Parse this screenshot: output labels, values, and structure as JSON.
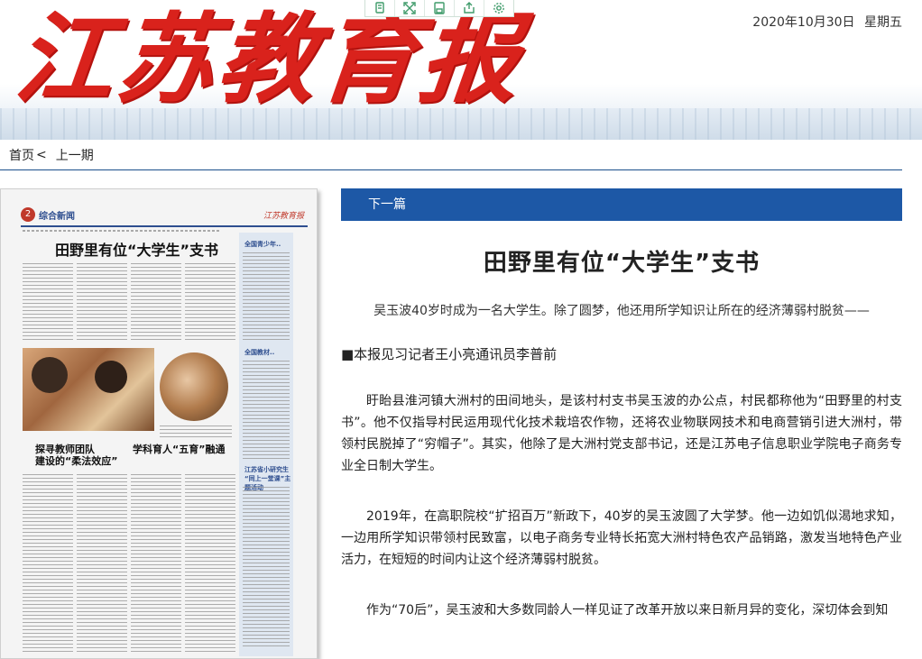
{
  "header": {
    "logo_text": "江苏教育报",
    "date": "2020年10月30日",
    "weekday": "星期五"
  },
  "toolbar": {
    "icons": [
      "copy-icon",
      "fullscreen-icon",
      "save-icon",
      "share-icon",
      "settings-icon"
    ]
  },
  "nav": {
    "home": "首页",
    "separator": "<",
    "prev_issue": "上一期"
  },
  "thumbnail": {
    "page_number": "2",
    "section": "综合新闻",
    "headline": "田野里有位“大学生”支书",
    "story2_title": "探寻教师团队\n建设的“柔法效应”",
    "story3_title": "学科育人“五育”融通",
    "side_title1": "全国青少年..",
    "side_title2": "全国教材..",
    "side_title3": "江苏省小研究生\n“同上一堂课”主题活动"
  },
  "article": {
    "next_label": "下一篇",
    "title": "田野里有位“大学生”支书",
    "subtitle": "吴玉波40岁时成为一名大学生。除了圆梦，他还用所学知识让所在的经济薄弱村脱贫——",
    "byline": "■本报见习记者王小亮通讯员李普前",
    "paragraphs": [
      "盱眙县淮河镇大洲村的田间地头，是该村村支书吴玉波的办公点，村民都称他为“田野里的村支书”。他不仅指导村民运用现代化技术栽培农作物，还将农业物联网技术和电商营销引进大洲村，带领村民脱掉了“穷帽子”。其实，他除了是大洲村党支部书记，还是江苏电子信息职业学院电子商务专业全日制大学生。",
      "2019年，在高职院校“扩招百万”新政下，40岁的吴玉波圆了大学梦。他一边如饥似渴地求知，一边用所学知识带领村民致富，以电子商务专业特长拓宽大洲村特色农产品销路，激发当地特色产业活力，在短短的时间内让这个经济薄弱村脱贫。",
      "作为“70后”，吴玉波和大多数同龄人一样见证了改革开放以来日新月异的变化，深切体会到知"
    ]
  },
  "colors": {
    "logo_red": "#d9221c",
    "nav_blue": "#1d58a6",
    "toolbar_green": "#3f9b6a"
  }
}
